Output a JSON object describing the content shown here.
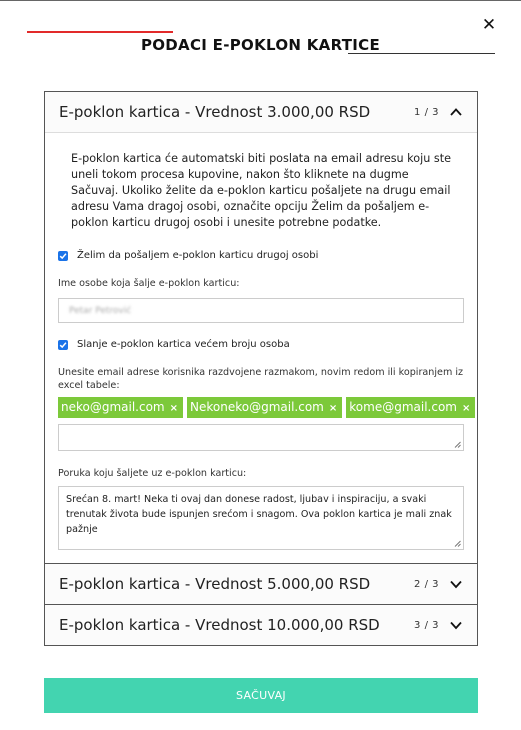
{
  "modal": {
    "title": "PODACI E-POKLON KARTICE",
    "close_symbol": "✕"
  },
  "cards": [
    {
      "title": "E-poklon kartica - Vrednost 3.000,00 RSD",
      "counter": "1 / 3",
      "expanded": true
    },
    {
      "title": "E-poklon kartica - Vrednost 5.000,00 RSD",
      "counter": "2 / 3",
      "expanded": false
    },
    {
      "title": "E-poklon kartica - Vrednost 10.000,00 RSD",
      "counter": "3 / 3",
      "expanded": false
    }
  ],
  "form": {
    "intro": "E-poklon kartica će automatski biti poslata na email adresu koju ste uneli tokom procesa kupovine, nakon što kliknete na dugme Sačuvaj. Ukoliko želite da e-poklon karticu pošaljete na drugu email adresu Vama dragoj osobi, označite opciju Želim da pošaljem e-poklon karticu drugoj osobi i unesite potrebne podatke.",
    "send_to_other_label": "Želim da pošaljem e-poklon karticu drugoj osobi",
    "send_to_other_checked": true,
    "sender_label": "Ime osobe koja šalje e-poklon karticu:",
    "sender_value": "Petar Petrović",
    "multiple_label": "Slanje e-poklon kartica većem broju osoba",
    "multiple_checked": true,
    "emails_label": "Unesite email adrese korisnika razdvojene razmakom, novim redom ili kopiranjem iz excel tabele:",
    "emails": [
      "neko@gmail.com",
      "Nekoneko@gmail.com",
      "kome@gmail.com"
    ],
    "tag_remove_symbol": "×",
    "message_label": "Poruka koju šaljete uz e-poklon karticu:",
    "message_value": "Srećan 8. mart! Neka ti ovaj dan donese radost, ljubav i inspiraciju, a svaki trenutak života bude ispunjen srećom i snagom. Ova poklon kartica je mali znak pažnje"
  },
  "save_label": "SAČUVAJ",
  "colors": {
    "accent_red": "#e22a2a",
    "tag_green": "#7cc93a",
    "save_teal": "#43d4b0",
    "checkbox_blue": "#1a73e8"
  },
  "icons": [
    "close-icon",
    "chevron-up-icon",
    "chevron-down-icon",
    "checkbox-checked-icon",
    "remove-tag-icon",
    "resize-grip-icon"
  ]
}
